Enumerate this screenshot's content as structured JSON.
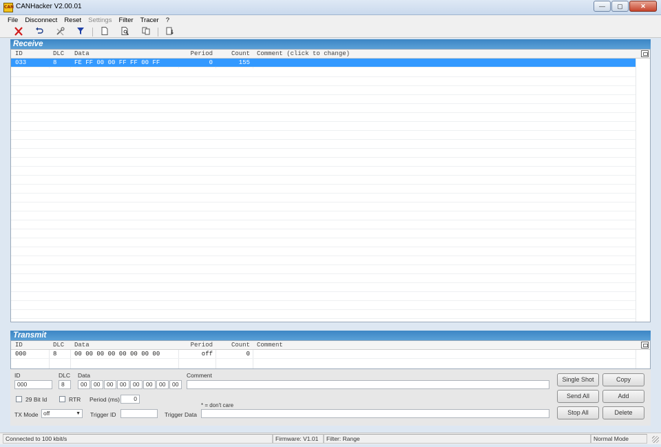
{
  "window": {
    "title": "CANHacker V2.00.01",
    "icon": "can-icon",
    "icon_text": "CAN",
    "minimize": "—",
    "maximize": "▢",
    "close": "✕"
  },
  "menu": [
    "File",
    "Disconnect",
    "Reset",
    "Settings",
    "Filter",
    "Tracer",
    "?"
  ],
  "toolbar": [
    "disconnect-icon",
    "undo-icon",
    "settings-icon",
    "filter-icon",
    "new-icon",
    "preview-icon",
    "copy-icon",
    "export-icon"
  ],
  "receive": {
    "title": "Receive",
    "columns": [
      "ID",
      "DLC",
      "Data",
      "Period",
      "Count",
      "Comment (click to change)"
    ],
    "rows": [
      {
        "id": "033",
        "dlc": "8",
        "data": "FE FF 00 00 FF FF 00 FF",
        "period": "0",
        "count": "155",
        "comment": ""
      }
    ]
  },
  "transmit": {
    "title": "Transmit",
    "columns": [
      "ID",
      "DLC",
      "Data",
      "Period",
      "Count",
      "Comment"
    ],
    "rows": [
      {
        "id": "000",
        "dlc": "8",
        "data": "00 00 00 00 00 00 00 00",
        "period": "off",
        "count": "0",
        "comment": ""
      }
    ]
  },
  "editor": {
    "id_label": "ID",
    "id_value": "000",
    "dlc_label": "DLC",
    "dlc_value": "8",
    "data_label": "Data",
    "data_bytes": [
      "00",
      "00",
      "00",
      "00",
      "00",
      "00",
      "00",
      "00"
    ],
    "comment_label": "Comment",
    "comment_value": "",
    "bit29_label": "29 Bit Id",
    "rtr_label": "RTR",
    "period_label": "Period (ms)",
    "period_value": "0",
    "dont_care_note": "* = don't care",
    "txmode_label": "TX Mode",
    "txmode_value": "off",
    "trigger_id_label": "Trigger ID",
    "trigger_id_value": "",
    "trigger_data_label": "Trigger Data",
    "trigger_data_value": "",
    "buttons": {
      "single_shot": "Single Shot",
      "copy": "Copy",
      "send_all": "Send All",
      "add": "Add",
      "stop_all": "Stop All",
      "delete": "Delete"
    }
  },
  "status": {
    "connection": "Connected to 100 kbit/s",
    "firmware": "Firmware: V1.01",
    "filter": "Filter: Range",
    "mode": "Normal Mode"
  },
  "colors": {
    "panel_header": "#3d86c4",
    "selection": "#3399ff"
  }
}
